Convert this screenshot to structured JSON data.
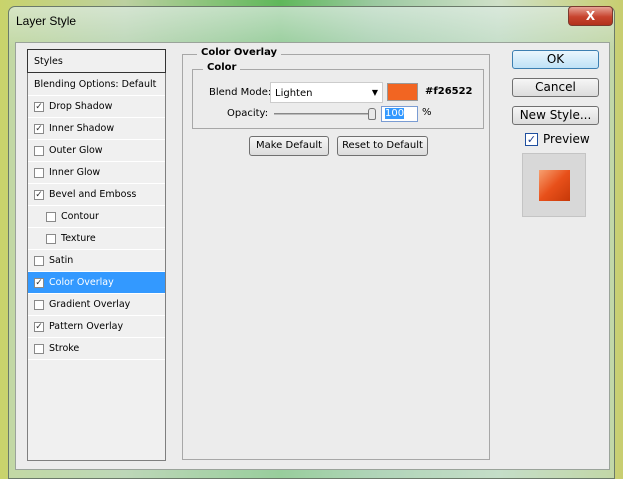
{
  "window": {
    "title": "Layer Style",
    "close": "X"
  },
  "styles_list": {
    "header": "Styles",
    "items": [
      {
        "label": "Blending Options: Default",
        "checkbox": false,
        "checked": false,
        "sub": false,
        "selected": false
      },
      {
        "label": "Drop Shadow",
        "checkbox": true,
        "checked": true,
        "sub": false,
        "selected": false
      },
      {
        "label": "Inner Shadow",
        "checkbox": true,
        "checked": true,
        "sub": false,
        "selected": false
      },
      {
        "label": "Outer Glow",
        "checkbox": true,
        "checked": false,
        "sub": false,
        "selected": false
      },
      {
        "label": "Inner Glow",
        "checkbox": true,
        "checked": false,
        "sub": false,
        "selected": false
      },
      {
        "label": "Bevel and Emboss",
        "checkbox": true,
        "checked": true,
        "sub": false,
        "selected": false
      },
      {
        "label": "Contour",
        "checkbox": true,
        "checked": false,
        "sub": true,
        "selected": false
      },
      {
        "label": "Texture",
        "checkbox": true,
        "checked": false,
        "sub": true,
        "selected": false
      },
      {
        "label": "Satin",
        "checkbox": true,
        "checked": false,
        "sub": false,
        "selected": false
      },
      {
        "label": "Color Overlay",
        "checkbox": true,
        "checked": true,
        "sub": false,
        "selected": true
      },
      {
        "label": "Gradient Overlay",
        "checkbox": true,
        "checked": false,
        "sub": false,
        "selected": false
      },
      {
        "label": "Pattern Overlay",
        "checkbox": true,
        "checked": true,
        "sub": false,
        "selected": false
      },
      {
        "label": "Stroke",
        "checkbox": true,
        "checked": false,
        "sub": false,
        "selected": false
      }
    ]
  },
  "panel": {
    "title": "Color Overlay",
    "color_group": "Color",
    "blend_mode_label": "Blend Mode:",
    "blend_mode": "Lighten",
    "color_hex": "#f26522",
    "opacity_label": "Opacity:",
    "opacity": "100",
    "opacity_unit": "%",
    "opacity_percent": 100,
    "make_default": "Make Default",
    "reset_default": "Reset to Default"
  },
  "buttons": {
    "ok": "OK",
    "cancel": "Cancel",
    "new_style": "New Style...",
    "preview": "Preview",
    "preview_checked": true
  }
}
